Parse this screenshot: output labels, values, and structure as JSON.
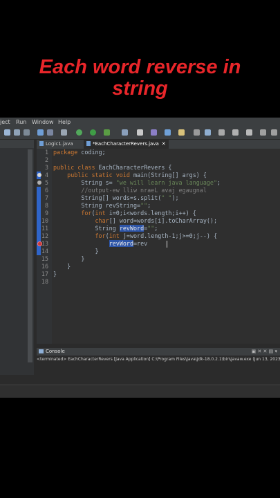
{
  "overlay": {
    "line1": "Each word reverse in",
    "line2": "string",
    "color": "#e8262a"
  },
  "menu": {
    "items": [
      "ject",
      "Run",
      "Window",
      "Help"
    ]
  },
  "editor": {
    "tabs": [
      {
        "label": "Logic1.java",
        "active": false
      },
      {
        "label": "*EachCharacterRevers.java",
        "active": true
      }
    ],
    "lines": [
      {
        "n": "1",
        "tokens": [
          {
            "t": "package",
            "c": "kw"
          },
          {
            "t": " coding;",
            "c": "tx"
          }
        ]
      },
      {
        "n": "2",
        "tokens": []
      },
      {
        "n": "3",
        "tokens": [
          {
            "t": "public class",
            "c": "kw"
          },
          {
            "t": " EachCharacterRevers {",
            "c": "tx"
          }
        ]
      },
      {
        "n": "4",
        "tokens": [
          {
            "t": "    public static void",
            "c": "kw"
          },
          {
            "t": " main(String[] args) {",
            "c": "tx"
          }
        ]
      },
      {
        "n": "5",
        "tokens": [
          {
            "t": "        String s= ",
            "c": "tx"
          },
          {
            "t": "\"we will learn java language\"",
            "c": "st"
          },
          {
            "t": ";",
            "c": "tx"
          }
        ]
      },
      {
        "n": "6",
        "tokens": [
          {
            "t": "        //output-ew lliw nraeL avaj egaugnal",
            "c": "cm"
          }
        ]
      },
      {
        "n": "7",
        "tokens": [
          {
            "t": "        String[] ",
            "c": "tx"
          },
          {
            "t": "words",
            "c": "tx"
          },
          {
            "t": "=s.split(",
            "c": "tx"
          },
          {
            "t": "\" \"",
            "c": "st"
          },
          {
            "t": ");",
            "c": "tx"
          }
        ]
      },
      {
        "n": "8",
        "tokens": [
          {
            "t": "        String revString=",
            "c": "tx"
          },
          {
            "t": "\"\"",
            "c": "st"
          },
          {
            "t": ";",
            "c": "tx"
          }
        ]
      },
      {
        "n": "9",
        "tokens": [
          {
            "t": "        ",
            "c": "tx"
          },
          {
            "t": "for",
            "c": "kw"
          },
          {
            "t": "(",
            "c": "tx"
          },
          {
            "t": "int",
            "c": "kw"
          },
          {
            "t": " i=0;i<words.length;i++) {",
            "c": "tx"
          }
        ]
      },
      {
        "n": "10",
        "tokens": [
          {
            "t": "            ",
            "c": "tx"
          },
          {
            "t": "char",
            "c": "kw"
          },
          {
            "t": "[] word=words[i].toCharArray();",
            "c": "tx"
          }
        ]
      },
      {
        "n": "11",
        "tokens": [
          {
            "t": "            String ",
            "c": "tx"
          },
          {
            "t": "revWord",
            "c": "hl"
          },
          {
            "t": "=",
            "c": "tx"
          },
          {
            "t": "\"\"",
            "c": "st"
          },
          {
            "t": ";",
            "c": "tx"
          }
        ]
      },
      {
        "n": "12",
        "tokens": [
          {
            "t": "            ",
            "c": "tx"
          },
          {
            "t": "for",
            "c": "kw"
          },
          {
            "t": "(",
            "c": "tx"
          },
          {
            "t": "int",
            "c": "kw"
          },
          {
            "t": " j=word.length-1;j>=0;j--) {",
            "c": "tx"
          }
        ]
      },
      {
        "n": "13",
        "tokens": [
          {
            "t": "                ",
            "c": "tx"
          },
          {
            "t": "revWord",
            "c": "hl"
          },
          {
            "t": "=rev",
            "c": "tx"
          }
        ]
      },
      {
        "n": "14",
        "tokens": [
          {
            "t": "            }",
            "c": "tx"
          }
        ]
      },
      {
        "n": "15",
        "tokens": [
          {
            "t": "        }",
            "c": "tx"
          }
        ]
      },
      {
        "n": "16",
        "tokens": [
          {
            "t": "    }",
            "c": "tx"
          }
        ]
      },
      {
        "n": "17",
        "tokens": [
          {
            "t": "}",
            "c": "tx"
          }
        ]
      },
      {
        "n": "18",
        "tokens": []
      }
    ]
  },
  "console": {
    "title": "Console",
    "status": "<terminated> EachCharacterRevers [Java Application] C:\\Program Files\\Java\\jdk-18.0.2.1\\bin\\javaw.exe  (Jun 13, 2023"
  },
  "icons": {
    "console": "console-icon",
    "toolbar": [
      "new-icon",
      "save-icon",
      "debug-icon",
      "run-icon",
      "search-icon"
    ]
  }
}
